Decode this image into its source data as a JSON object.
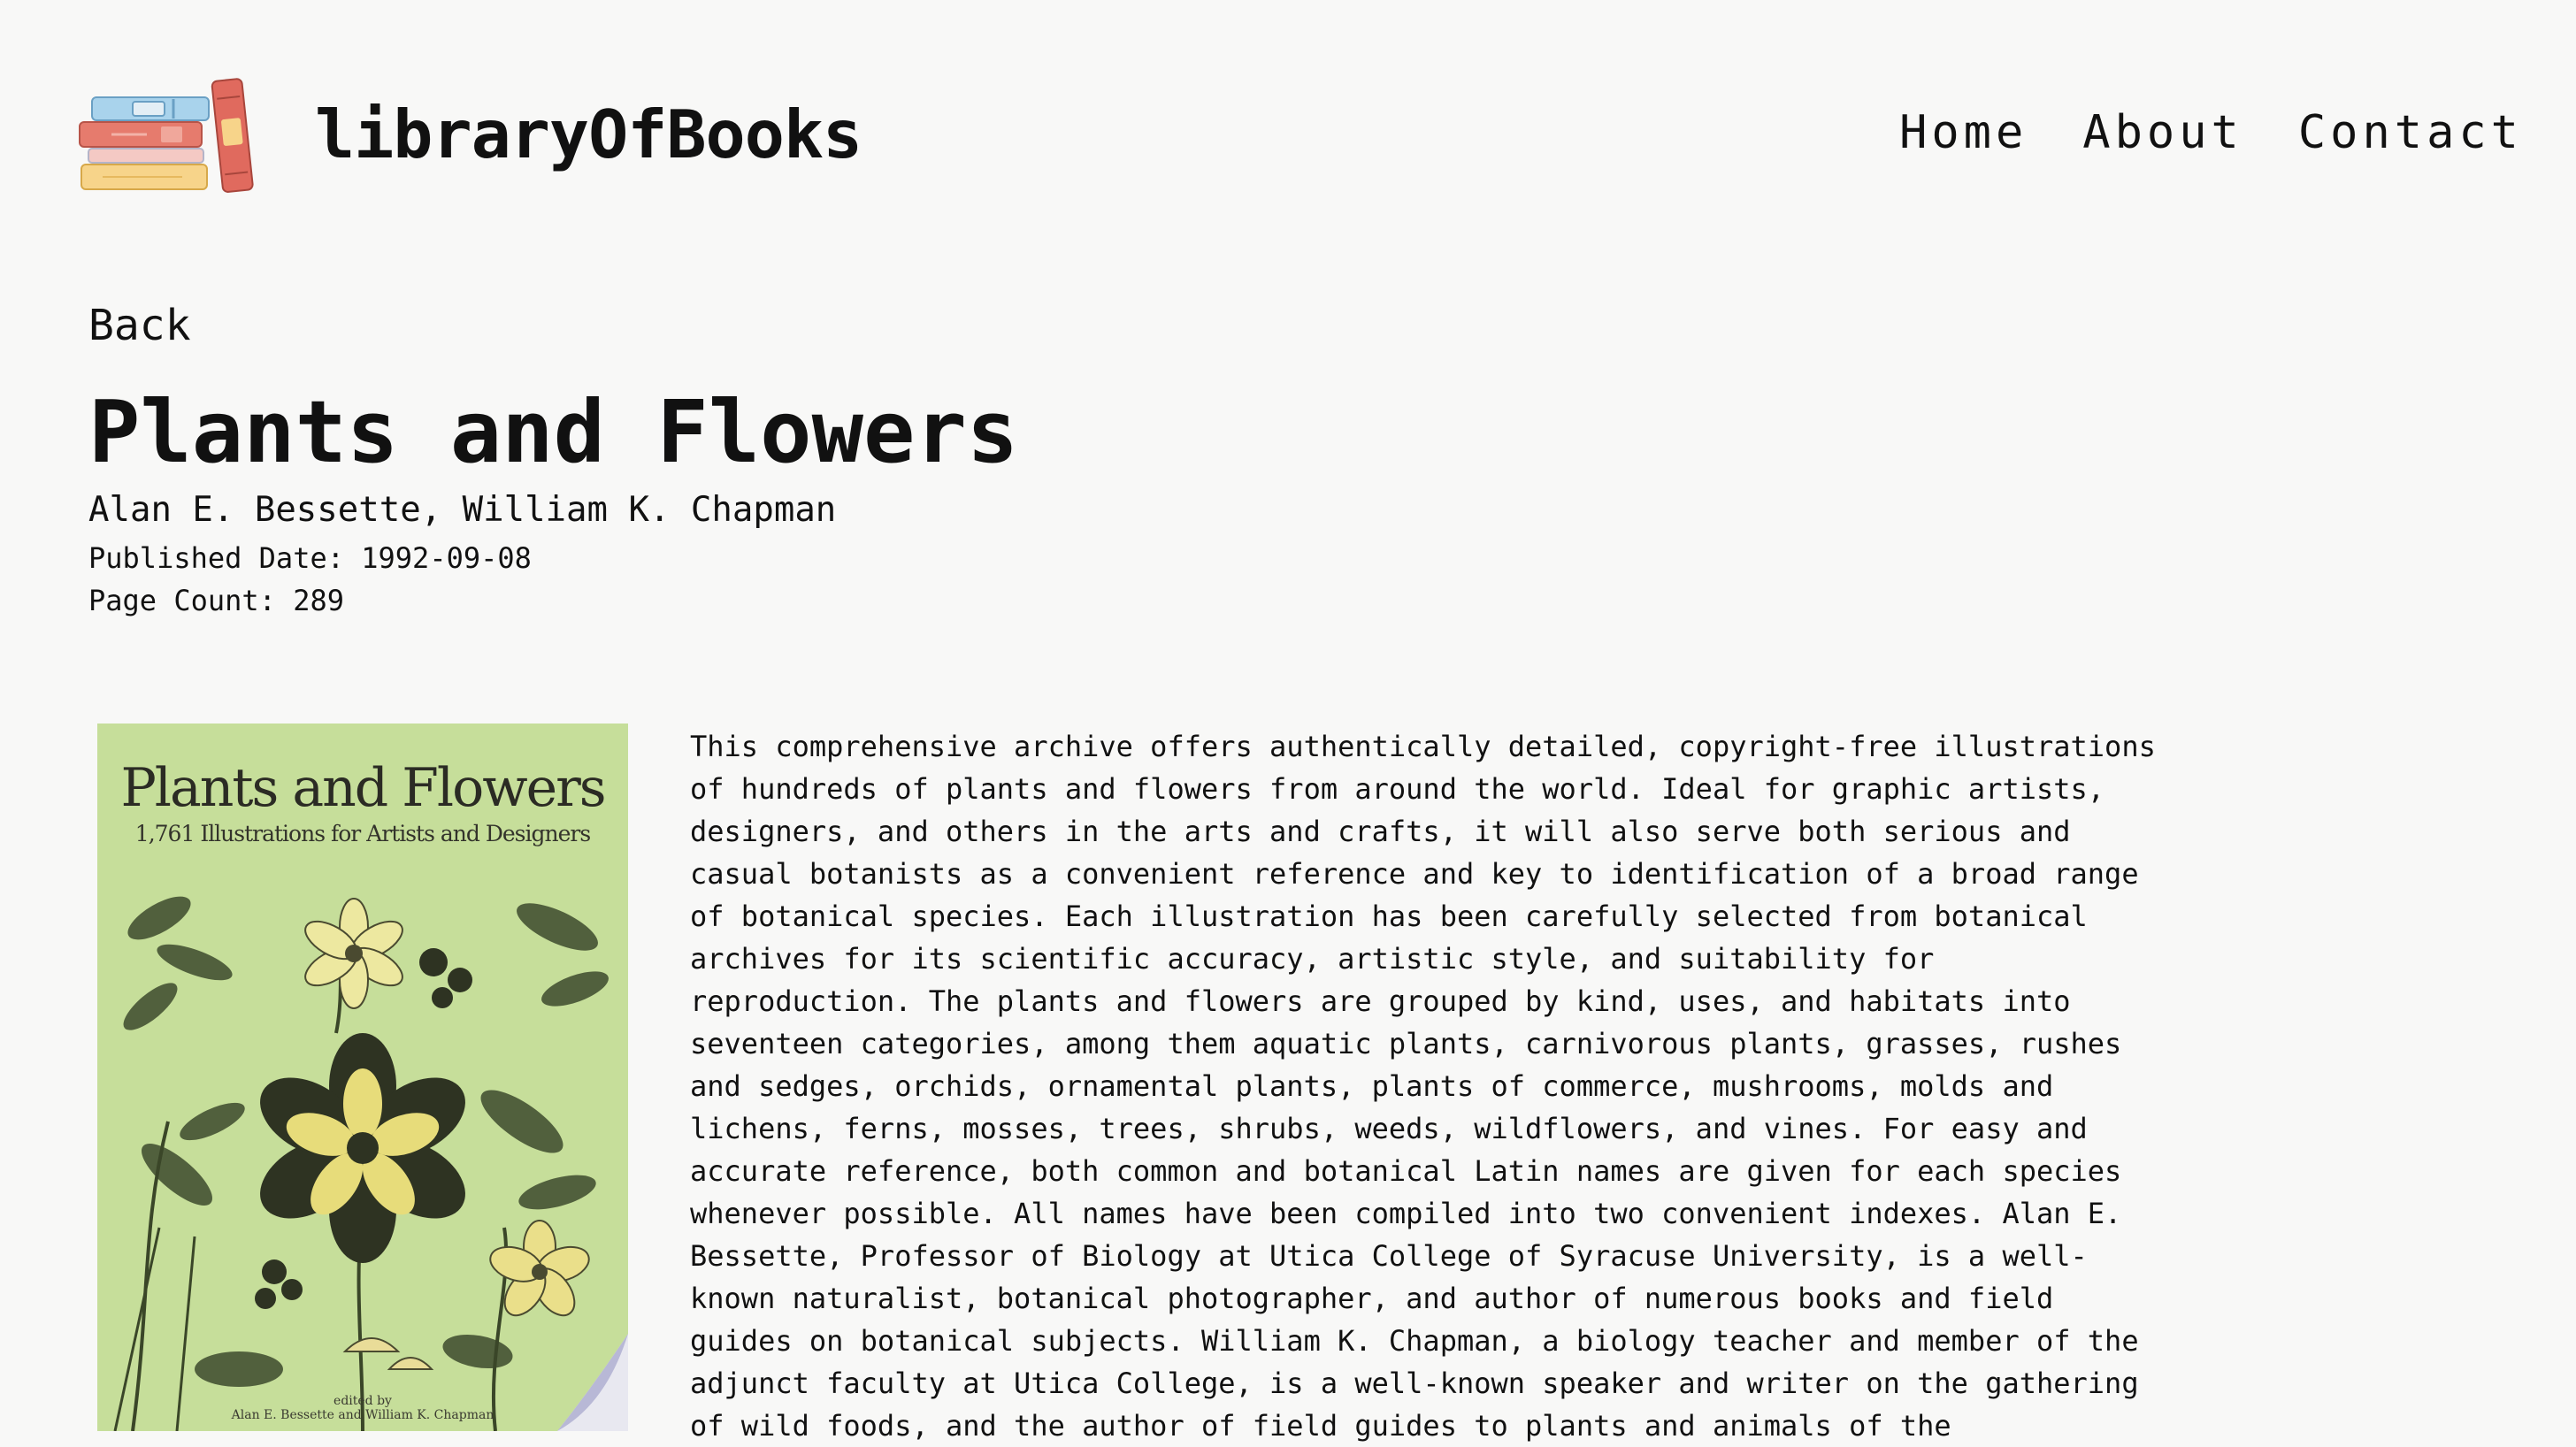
{
  "header": {
    "brand": "libraryOfBooks",
    "nav": [
      "Home",
      "About",
      "Contact"
    ]
  },
  "book": {
    "back_label": "Back",
    "title": "Plants and Flowers",
    "authors": "Alan E. Bessette, William K. Chapman",
    "published_date": "Published Date: 1992-09-08",
    "page_count": "Page Count: 289",
    "cover": {
      "title": "Plants and Flowers",
      "subtitle": "1,761 Illustrations for Artists and Designers",
      "editors": "edited by\nAlan E. Bessette and William K. Chapman"
    },
    "description_lines": [
      "This comprehensive archive offers authentically detailed, copyright-free illustrations",
      "of hundreds of plants and flowers from around the world. Ideal for graphic artists,",
      "designers, and others in the arts and crafts, it will also serve both serious and",
      "casual botanists as a convenient reference and key to identification of a broad range",
      "of botanical species. Each illustration has been carefully selected from botanical",
      "archives for its scientific accuracy, artistic style, and suitability for",
      "reproduction. The plants and flowers are grouped by kind, uses, and habitats into",
      "seventeen categories, among them aquatic plants, carnivorous plants, grasses, rushes",
      "and sedges, orchids, ornamental plants, plants of commerce, mushrooms, molds and",
      "lichens, ferns, mosses, trees, shrubs, weeds, wildflowers, and vines. For easy and",
      "accurate reference, both common and botanical Latin names are given for each species",
      "whenever possible. All names have been compiled into two convenient indexes. Alan E.",
      "Bessette, Professor of Biology at Utica College of Syracuse University, is a well-",
      "known naturalist, botanical photographer, and author of numerous books and field",
      "guides on botanical subjects. William K. Chapman, a biology teacher and member of the",
      "adjunct faculty at Utica College, is a well-known speaker and writer on the gathering",
      "of wild foods, and the author of field guides to plants and animals of the"
    ]
  },
  "colors": {
    "background": "#f8f8f7",
    "text": "#111111",
    "cover_background": "#c6de9a"
  },
  "icons": {
    "logo": "stacked-books-icon"
  }
}
